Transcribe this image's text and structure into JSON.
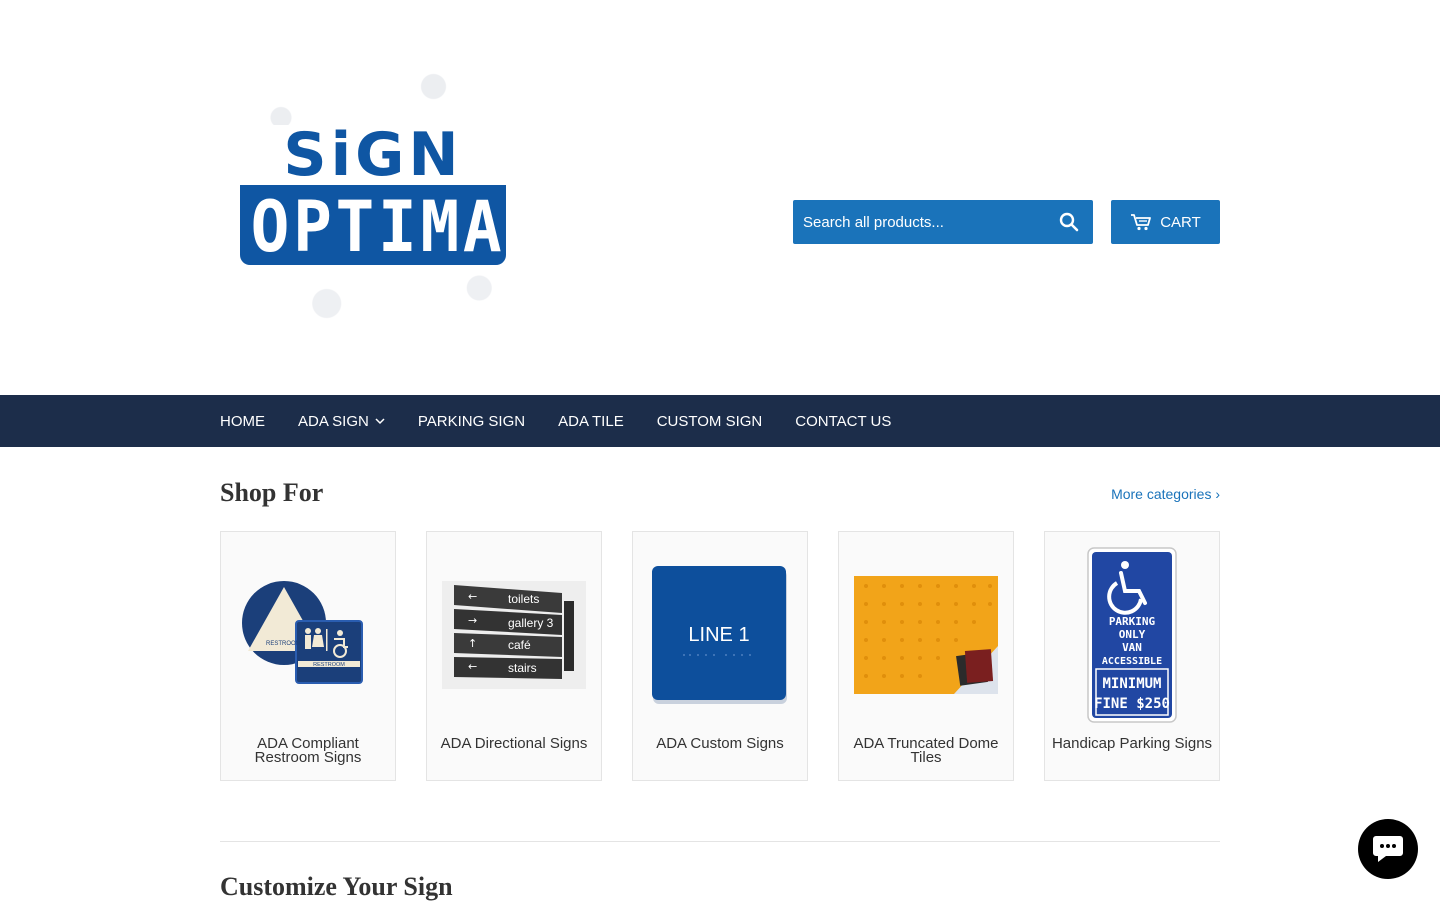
{
  "brand": {
    "logo_top": "SiGN",
    "logo_bottom": "OPTIMA",
    "accent": "#1a73ba",
    "logo_blue": "#0f56a3",
    "nav_bg": "#1c2d4a"
  },
  "header": {
    "search": {
      "placeholder": "Search all products..."
    },
    "cart_label": "CART"
  },
  "nav": {
    "items": [
      {
        "label": "HOME"
      },
      {
        "label": "ADA SIGN",
        "has_dropdown": true
      },
      {
        "label": "PARKING SIGN"
      },
      {
        "label": "ADA TILE"
      },
      {
        "label": "CUSTOM SIGN"
      },
      {
        "label": "CONTACT US"
      }
    ]
  },
  "shop_for": {
    "title": "Shop For",
    "more_link": "More categories ›",
    "cards": [
      {
        "label": "ADA Compliant Restroom Signs",
        "img_text": "RESTROOM"
      },
      {
        "label": "ADA Directional Signs",
        "img_rows": [
          "toilets",
          "gallery 3",
          "café",
          "stairs"
        ]
      },
      {
        "label": "ADA Custom Signs",
        "img_text": "LINE 1"
      },
      {
        "label": "ADA Truncated Dome Tiles"
      },
      {
        "label": "Handicap Parking Signs",
        "img_lines": [
          "PARKING",
          "ONLY",
          "VAN",
          "ACCESSIBLE",
          "MINIMUM",
          "FINE $250"
        ]
      }
    ]
  },
  "customize": {
    "title": "Customize Your Sign"
  }
}
